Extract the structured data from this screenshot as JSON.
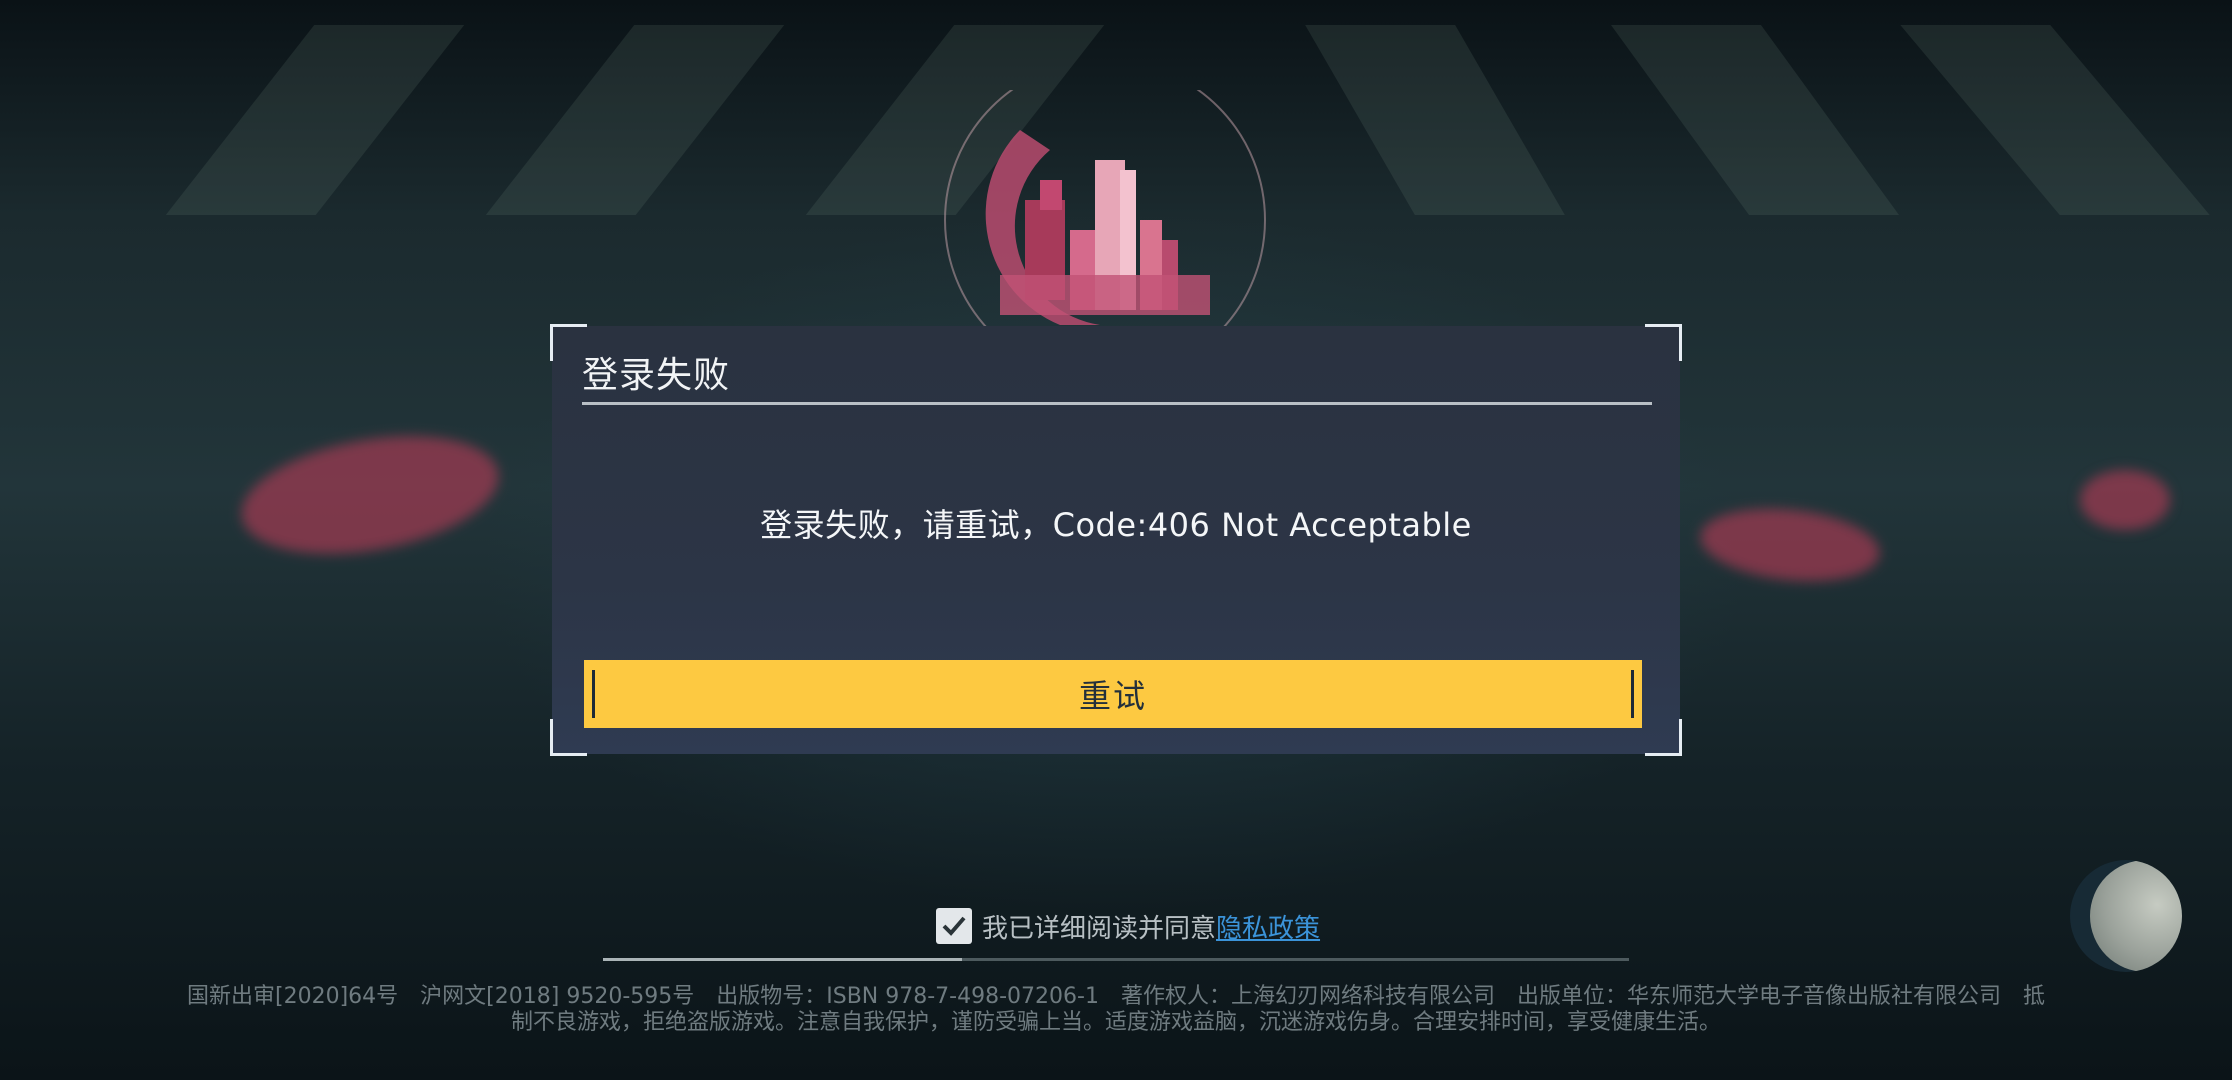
{
  "dialog": {
    "title": "登录失败",
    "message": "登录失败，请重试，Code:406 Not Acceptable",
    "retry_label": "重试"
  },
  "agreement": {
    "checked": true,
    "text": "我已详细阅读并同意",
    "link_label": "隐私政策"
  },
  "loading": {
    "progress": 0.35
  },
  "footer": {
    "line1": "国新出审[2020]64号　沪网文[2018] 9520-595号　出版物号：ISBN 978-7-498-07206-1　著作权人：上海幻刃网络科技有限公司　出版单位：华东师范大学电子音像出版社有限公司　抵",
    "line2": "制不良游戏，拒绝盗版游戏。注意自我保护，谨防受骗上当。适度游戏益脑，沉迷游戏伤身。合理安排时间，享受健康生活。"
  },
  "icons": {
    "corner_bracket": "corner-bracket-icon",
    "checkbox": "checkmark-icon",
    "moon": "moon-icon",
    "logo": "city-globe-logo"
  },
  "colors": {
    "button": "#fdc941",
    "link": "#3b93d8",
    "dialog_bg": "#2a3240"
  }
}
